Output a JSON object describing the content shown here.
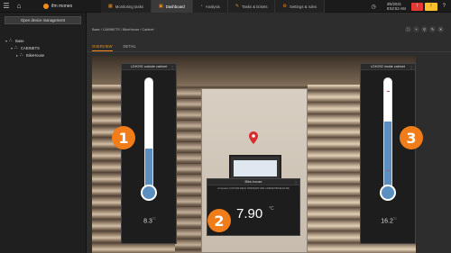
{
  "app": {
    "brand": "ifm moneo"
  },
  "topnav": {
    "tabs": [
      {
        "label": "Monitoring tasks",
        "icon": "monitor-icon",
        "active": false
      },
      {
        "label": "Dashboard",
        "icon": "dashboard-icon",
        "active": true
      },
      {
        "label": "Analysis",
        "icon": "analysis-icon",
        "active": false
      },
      {
        "label": "Tasks & tickets",
        "icon": "tickets-icon",
        "active": false
      },
      {
        "label": "Settings & rules",
        "icon": "settings-icon",
        "active": false
      }
    ],
    "date": "3/5/2021",
    "time": "8:52:52 AM",
    "alarm_red": "!",
    "alarm_yellow": "!",
    "icons": [
      "clock-icon",
      "help-icon"
    ]
  },
  "sidebar": {
    "button_label": "Open device management",
    "tree": [
      {
        "label": "Base",
        "level": 0,
        "expanded": true
      },
      {
        "label": "CABINETS",
        "level": 1,
        "expanded": true
      },
      {
        "label": "BikeHouse",
        "level": 2,
        "expanded": false
      }
    ]
  },
  "main": {
    "breadcrumb": "Base / CABINETS / BikeHouse / Cabinet",
    "subtabs": [
      {
        "label": "OVERVIEW",
        "active": true
      },
      {
        "label": "DETAIL",
        "active": false
      }
    ],
    "toolbar_icons": [
      "expand-icon",
      "add-icon",
      "pin-icon",
      "edit-icon",
      "delete-icon"
    ]
  },
  "widgets": {
    "left_thermo": {
      "title": "LDH292 outside cabinet",
      "value": "8.3",
      "unit": "°C",
      "fill": 0.38
    },
    "right_thermo": {
      "title": "LDH292 inside cabinet",
      "value": "16.2",
      "unit": "°C",
      "fill": 0.62
    },
    "humidity": {
      "title": "Bike-house",
      "label": "ef-location:CUSTOM:RECH TEMPERATURE:CABINET:BIKEHOUSE",
      "value": "7.90",
      "unit": "°C"
    }
  },
  "markers": [
    "1",
    "2",
    "3"
  ],
  "colors": {
    "accent": "#f28c1a",
    "marker": "#f07d1a",
    "thermo_fill": "#5a8fbf"
  }
}
